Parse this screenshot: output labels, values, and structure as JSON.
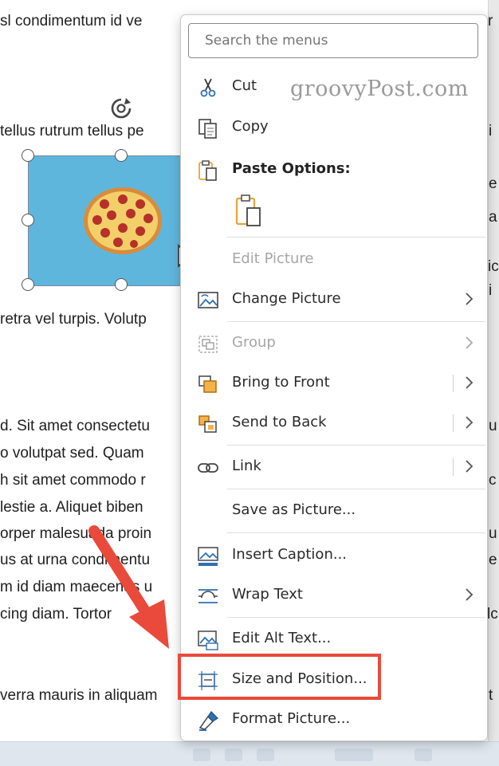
{
  "document": {
    "lines": [
      "sl condimentum id ve",
      "tellus rutrum tellus pe",
      "retra vel turpis. Volutp",
      "d. Sit amet consectetu",
      "o volutpat sed. Quam",
      "h sit amet commodo r",
      "lestie a. Aliquet biben",
      "orper malesuada proin",
      "us at urna condimentu",
      "m id diam maecenas u",
      "cing diam. Tortor",
      "verra mauris in aliquam"
    ],
    "right_edge": [
      "r",
      "i",
      "e",
      "a",
      "ic",
      "i",
      "u",
      "c",
      "u",
      "e",
      "lc",
      "t"
    ]
  },
  "context_menu": {
    "search_placeholder": "Search the menus",
    "items": [
      {
        "label": "Cut",
        "icon": "scissors-icon"
      },
      {
        "label": "Copy",
        "icon": "copy-icon"
      },
      {
        "label": "Paste Options:",
        "icon": "paste-icon"
      },
      {
        "label": "Edit Picture",
        "icon": ""
      },
      {
        "label": "Change Picture",
        "icon": "change-picture-icon"
      },
      {
        "label": "Group",
        "icon": "group-icon"
      },
      {
        "label": "Bring to Front",
        "icon": "bring-to-front-icon"
      },
      {
        "label": "Send to Back",
        "icon": "send-to-back-icon"
      },
      {
        "label": "Link",
        "icon": "link-icon"
      },
      {
        "label": "Save as Picture...",
        "icon": ""
      },
      {
        "label": "Insert Caption...",
        "icon": "insert-caption-icon"
      },
      {
        "label": "Wrap Text",
        "icon": "wrap-text-icon"
      },
      {
        "label": "Edit Alt Text...",
        "icon": "alt-text-icon"
      },
      {
        "label": "Size and Position...",
        "icon": "size-position-icon"
      },
      {
        "label": "Format Picture...",
        "icon": "format-picture-icon"
      }
    ]
  },
  "watermark": "groovyPost.com",
  "colors": {
    "highlight": "#e94a3c",
    "picture_bg": "#5fb6dd",
    "icon_orange": "#e8a33b",
    "icon_blue": "#2f6fb3"
  }
}
